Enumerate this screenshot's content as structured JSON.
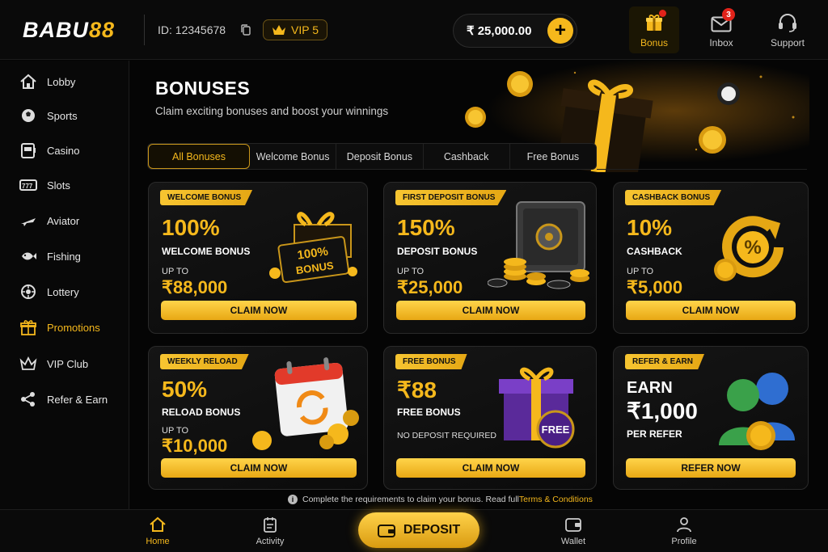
{
  "brand": {
    "logo_white": "BABU",
    "logo_gold": "88"
  },
  "user": {
    "id_text": "ID: 12345678",
    "vip_label": "VIP 5"
  },
  "balance": {
    "amount": "₹ 25,000.00",
    "add_symbol": "+"
  },
  "top_nav": [
    {
      "label": "Bonus",
      "icon": "gift-icon",
      "active": true
    },
    {
      "label": "Inbox",
      "icon": "mail-icon",
      "badge": "3"
    },
    {
      "label": "Support",
      "icon": "headset-icon"
    }
  ],
  "sidebar": {
    "items": [
      {
        "label": "Lobby",
        "icon": "home-icon"
      },
      {
        "label": "Sports",
        "icon": "ball-icon"
      },
      {
        "label": "Casino",
        "icon": "slot-machine-icon"
      },
      {
        "label": "Slots",
        "icon": "reels-icon"
      },
      {
        "label": "Aviator",
        "icon": "plane-icon"
      },
      {
        "label": "Fishing",
        "icon": "fish-icon"
      },
      {
        "label": "Lottery",
        "icon": "lottery-ball-icon"
      },
      {
        "label": "Promotions",
        "icon": "gift-icon",
        "active": true
      },
      {
        "label": "VIP Club",
        "icon": "crown-icon"
      },
      {
        "label": "Refer & Earn",
        "icon": "share-icon"
      }
    ]
  },
  "page": {
    "title": "BONUSES",
    "subtitle": "Claim exciting bonuses and boost your winnings"
  },
  "tabs": [
    {
      "label": "All Bonuses",
      "active": true
    },
    {
      "label": "Welcome Bonus"
    },
    {
      "label": "Deposit Bonus"
    },
    {
      "label": "Cashback"
    },
    {
      "label": "Free Bonus"
    }
  ],
  "cards": [
    {
      "tag": "WELCOME BONUS",
      "big": "100%",
      "label": "WELCOME BONUS",
      "upto": "UP TO",
      "amount": "₹88,000",
      "button": "CLAIM NOW",
      "art_text_1": "100%",
      "art_text_2": "BONUS"
    },
    {
      "tag": "FIRST DEPOSIT BONUS",
      "big": "150%",
      "label": "DEPOSIT BONUS",
      "upto": "UP TO",
      "amount": "₹25,000",
      "button": "CLAIM NOW"
    },
    {
      "tag": "CASHBACK BONUS",
      "big": "10%",
      "label": "CASHBACK",
      "upto": "UP TO",
      "amount": "₹5,000",
      "button": "CLAIM NOW"
    },
    {
      "tag": "WEEKLY RELOAD",
      "big": "50%",
      "label": "RELOAD BONUS",
      "upto": "UP TO",
      "amount": "₹10,000",
      "button": "CLAIM NOW"
    },
    {
      "tag": "FREE BONUS",
      "big": "₹88",
      "label": "FREE BONUS",
      "note": "NO DEPOSIT REQUIRED",
      "button": "CLAIM NOW",
      "art_text": "FREE"
    },
    {
      "tag": "REFER & EARN",
      "big": "EARN",
      "amount": "₹1,000",
      "label": "PER REFER",
      "button": "REFER NOW"
    }
  ],
  "footer_note": {
    "text": "Complete the requirements to claim your bonus. Read full ",
    "link": "Terms & Conditions"
  },
  "bottom_nav": [
    {
      "label": "Home",
      "active": true
    },
    {
      "label": "Activity"
    },
    {
      "label": "DEPOSIT"
    },
    {
      "label": "Wallet"
    },
    {
      "label": "Profile"
    }
  ],
  "colors": {
    "accent": "#f5b81c",
    "background": "#050505",
    "badge": "#e2231a"
  }
}
